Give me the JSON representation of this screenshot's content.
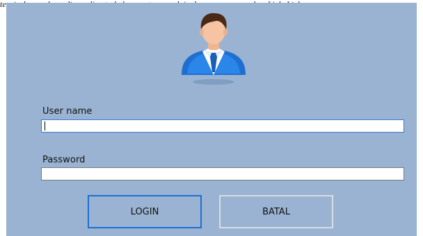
{
  "caption": "terpisah yang kemudian saling terhubung satu sama lain dengan menggunakan Link. Link",
  "form": {
    "username_label": "User name",
    "username_value": "",
    "password_label": "Password",
    "password_value": "",
    "login_label": "LOGIN",
    "cancel_label": "BATAL"
  },
  "colors": {
    "background": "#9ab3d2",
    "primary_button_border": "#1c6fd0",
    "secondary_button_border": "#d8dde3",
    "focused_field_border": "#2e7dd1"
  },
  "icons": {
    "avatar": "user-avatar-icon"
  }
}
